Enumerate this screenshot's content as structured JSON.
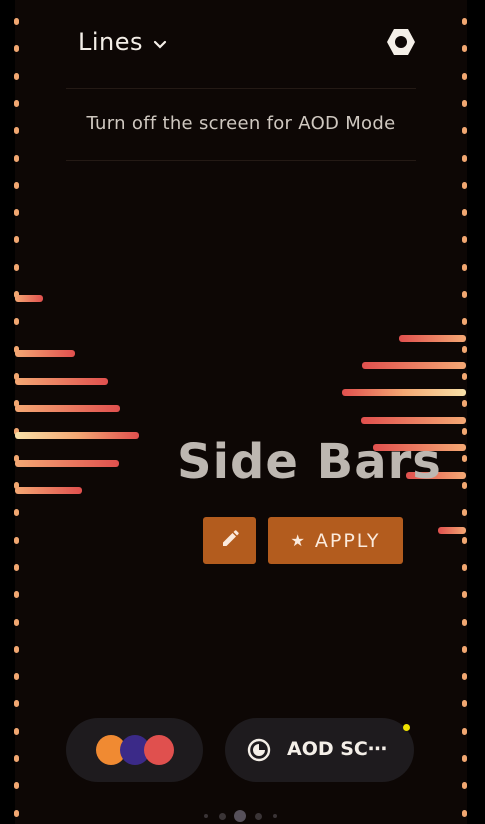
{
  "header": {
    "title": "Lines",
    "chevron_icon": "chevron-down-icon",
    "settings_icon": "hexagon-settings-icon"
  },
  "hint": "Turn off the screen for AOD Mode",
  "preview": {
    "title": "Side Bars",
    "edit_icon": "pencil-icon",
    "apply_icon": "star-icon",
    "apply_label": "APPLY"
  },
  "bottom": {
    "palette_colors": [
      "#f08a32",
      "#3b2a88",
      "#e0504e"
    ],
    "aod_label": "AOD SC⋯",
    "aod_icon": "half-moon-clock-icon",
    "notification_color": "#f0e200"
  },
  "pager": {
    "pages": 5,
    "active": 2
  },
  "colors": {
    "background": "#0d0705",
    "accent": "#b35c1e",
    "bar_red": "#e0504e",
    "bar_orange": "#f4a874",
    "bar_cream": "#f8e0a8"
  }
}
